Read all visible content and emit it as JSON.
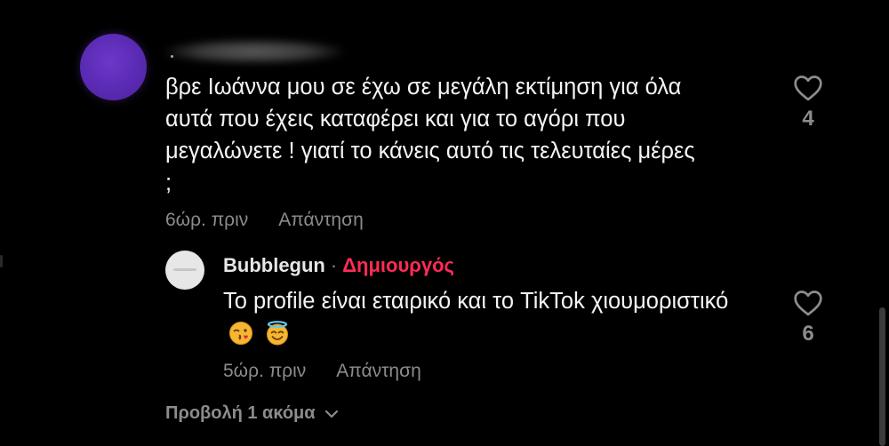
{
  "comment": {
    "author_name": "",
    "text": "βρε Ιωάννα μου σε έχω σε μεγάλη εκτίμηση για όλα\nαυτά που έχεις καταφέρει και για το αγόρι που\nμεγαλώνετε ! γιατί το κάνεις αυτό τις τελευταίες μέρες\n;",
    "time": "6ώρ. πριν",
    "reply_label": "Απάντηση",
    "likes": "4",
    "avatar_color": "#5b2db5"
  },
  "reply": {
    "author": "Bubblegun",
    "separator": "·",
    "badge": "Δημιουργός",
    "badge_color": "#fe2c55",
    "text": "Το profile είναι εταιρικό και το TikTok χιουμοριστικό",
    "emojis": [
      "kissing-face-emoji",
      "smiling-halo-face-emoji"
    ],
    "time": "5ώρ. πριν",
    "reply_label": "Απάντηση",
    "likes": "6"
  },
  "view_more": {
    "label": "Προβολή 1 ακόμα",
    "icon": "chevron-down-icon"
  },
  "icons": {
    "like": "heart-outline-icon"
  }
}
